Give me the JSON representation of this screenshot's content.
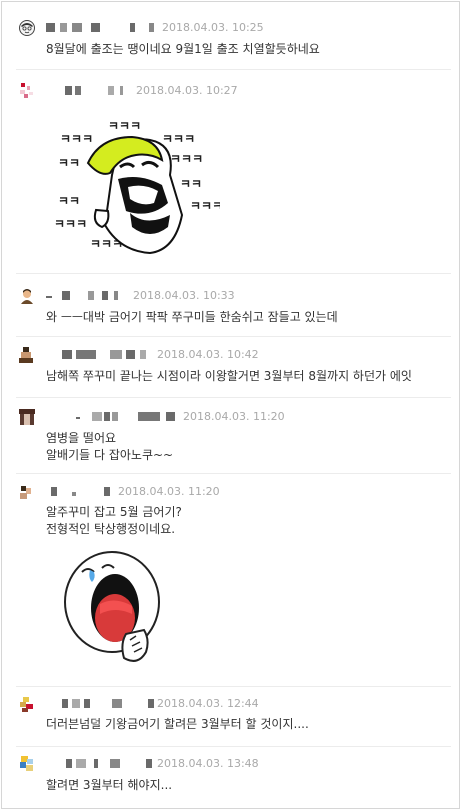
{
  "comments": [
    {
      "date": "2018.04.03. 10:25",
      "lines": [
        "8월달에 출조는 땡이네요 9월1일 출조 치열할듯하네요"
      ]
    },
    {
      "date": "2018.04.03. 10:27",
      "lines": [],
      "sticker": {
        "name": "laughing-man-sticker",
        "laugh_text": "ㅋㅋㅋ",
        "laugh_short": "ㅋㅋ"
      }
    },
    {
      "date": "2018.04.03. 10:33",
      "lines": [
        "와 ㅡㅡ대박 금어기 팍팍 쭈구미들 한숨쉬고 잠들고 있는데"
      ]
    },
    {
      "date": "2018.04.03. 10:42",
      "lines": [
        "남해쪽 쭈꾸미 끝나는 시점이라 이왕할거면 3월부터 8월까지 하던가 에잇"
      ]
    },
    {
      "date": "2018.04.03. 11:20",
      "lines": [
        "염병을 떨어요",
        "알배기들 다 잡아노쿠~~"
      ]
    },
    {
      "date": "2018.04.03. 11:20",
      "lines": [
        "알주꾸미 잡고 5월 금어기?",
        "전형적인 탁상행정이네요."
      ],
      "sticker": {
        "name": "crying-face-sticker"
      }
    },
    {
      "date": "2018.04.03. 12:44",
      "lines": [
        "더러븐넘덜 기왕금어기 할려믄 3월부터 할 것이지...."
      ]
    },
    {
      "date": "2018.04.03. 13:48",
      "lines": [
        "할려면 3월부터 해야지..."
      ]
    }
  ]
}
